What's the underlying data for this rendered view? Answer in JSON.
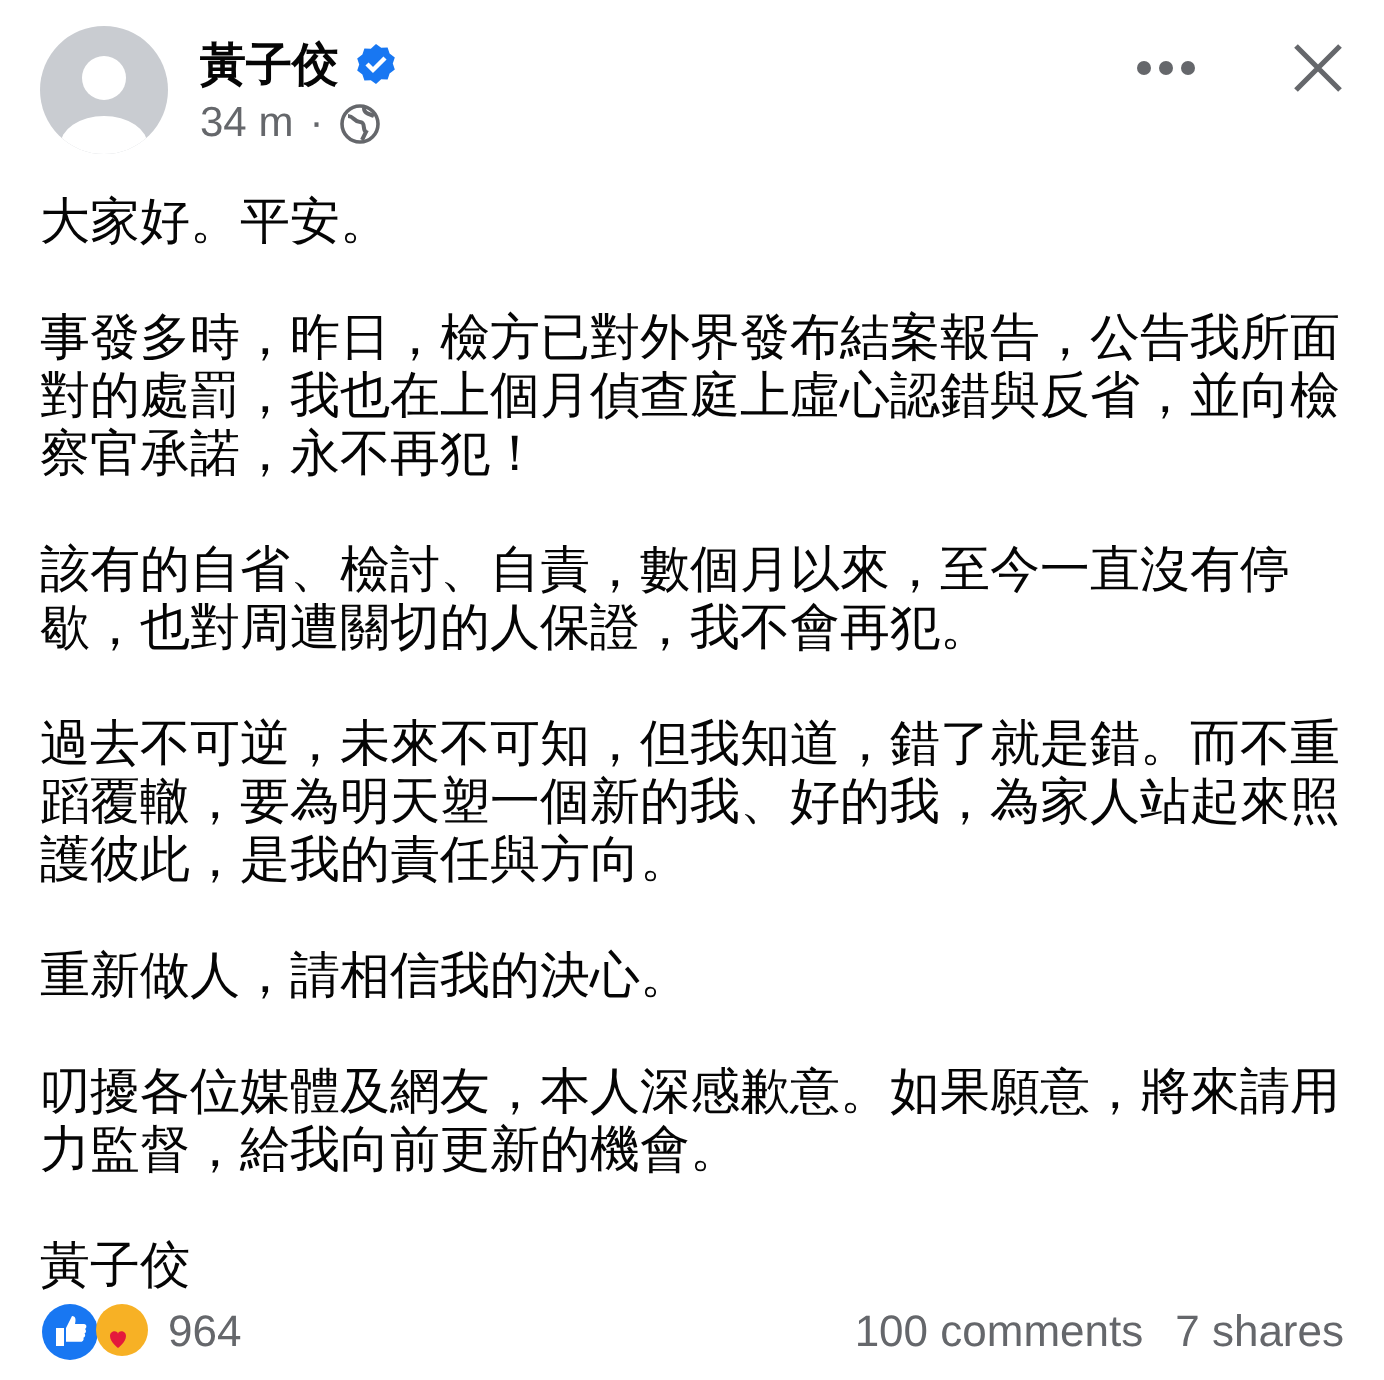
{
  "post": {
    "author": "黃子佼",
    "verified": true,
    "time": "34 m",
    "separator": "·",
    "paragraphs": [
      "大家好。平安。",
      "事發多時，昨日，檢方已對外界發布結案報告，公告我所面對的處罰，我也在上個月偵查庭上虛心認錯與反省，並向檢察官承諾，永不再犯！",
      "該有的自省、檢討、自責，數個月以來，至今一直沒有停歇，也對周遭關切的人保證，我不會再犯。",
      "過去不可逆，未來不可知，但我知道，錯了就是錯。而不重蹈覆轍，要為明天塑一個新的我、好的我，為家人站起來照護彼此，是我的責任與方向。",
      "重新做人，請相信我的決心。",
      "叨擾各位媒體及網友，本人深感歉意。如果願意，將來請用力監督，給我向前更新的機會。",
      "黃子佼"
    ]
  },
  "footer": {
    "reactions": "964",
    "comments": "100 comments",
    "shares": "7 shares"
  }
}
